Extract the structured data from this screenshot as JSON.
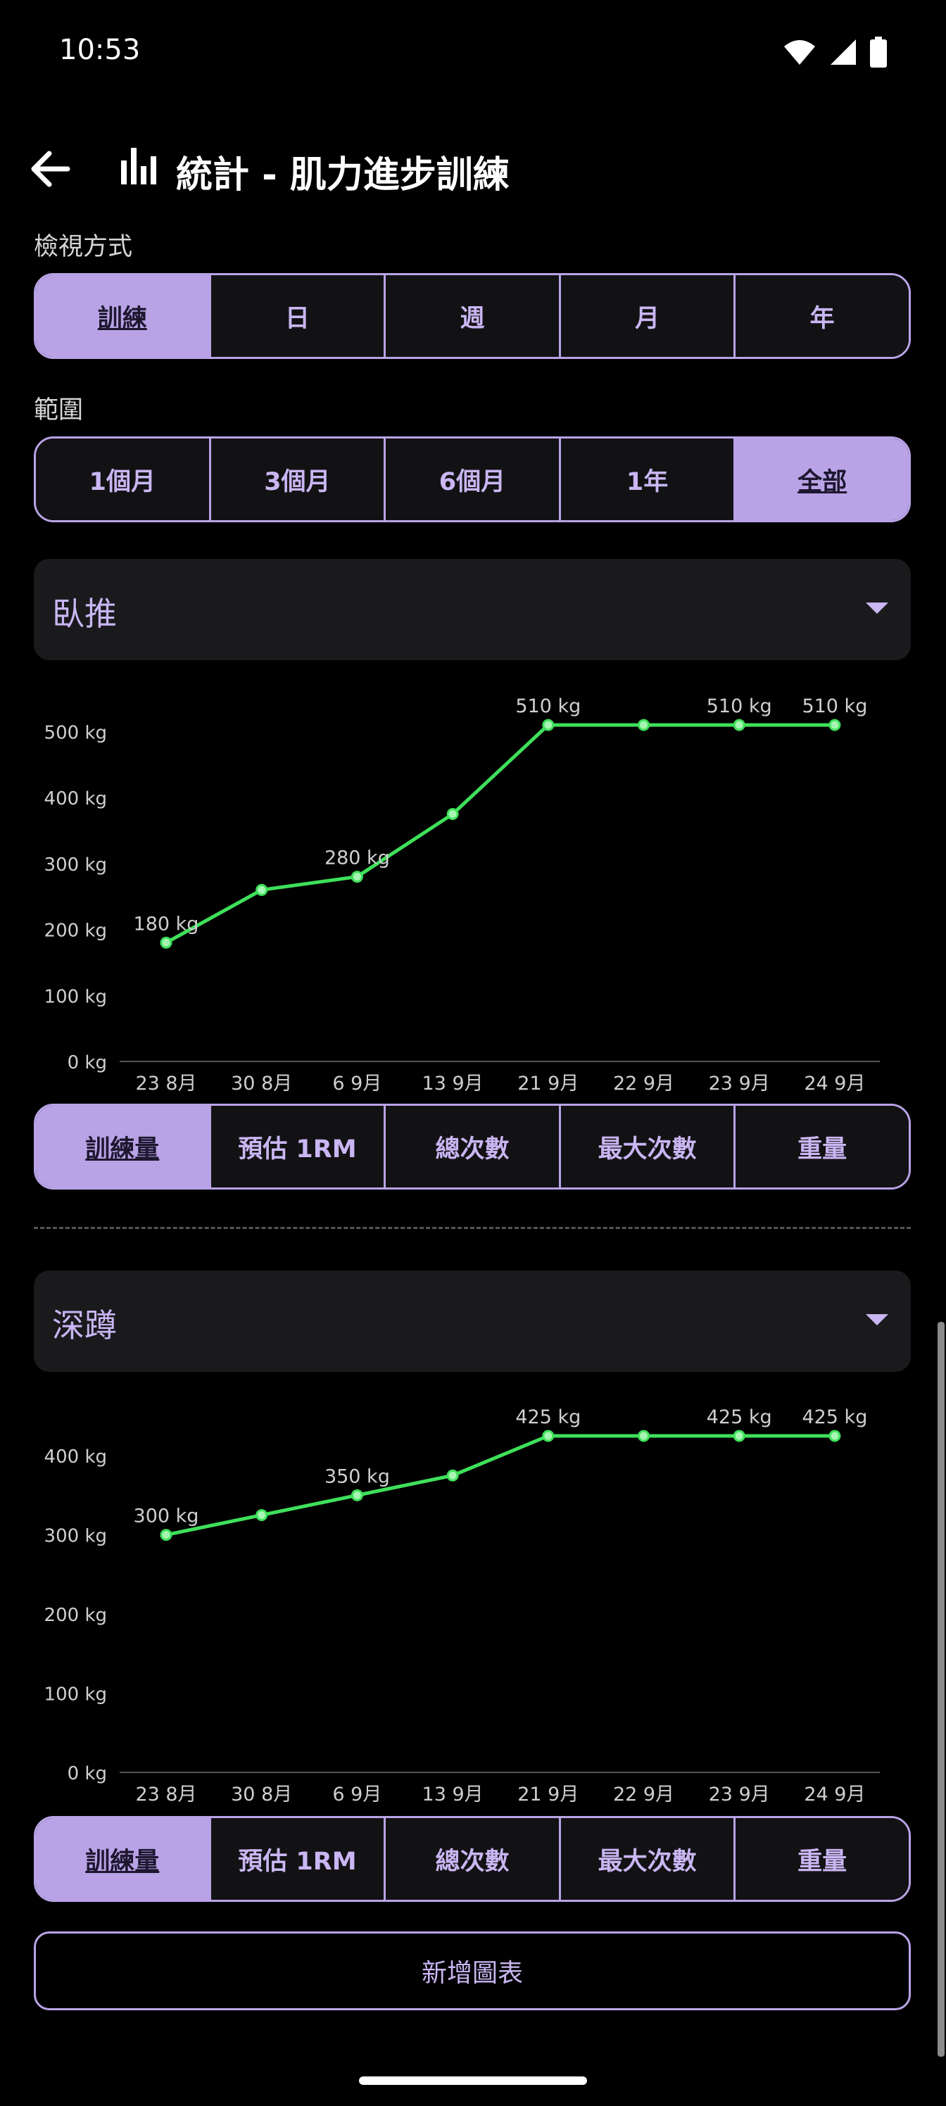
{
  "status": {
    "time": "10:53"
  },
  "header": {
    "title": "統計 - 肌力進步訓練"
  },
  "view_mode": {
    "label": "檢視方式",
    "options": [
      "訓練",
      "日",
      "週",
      "月",
      "年"
    ],
    "selected": "訓練"
  },
  "range": {
    "label": "範圍",
    "options": [
      "1個月",
      "3個月",
      "6個月",
      "1年",
      "全部"
    ],
    "selected": "全部"
  },
  "metric_options": [
    "訓練量",
    "預估 1RM",
    "總次數",
    "最大次數",
    "重量"
  ],
  "charts": [
    {
      "exercise": "臥推",
      "selected_metric": "訓練量",
      "chart_data": {
        "type": "line",
        "categories": [
          "23 8月",
          "30 8月",
          "6 9月",
          "13 9月",
          "21 9月",
          "22 9月",
          "23 9月",
          "24 9月"
        ],
        "values": [
          180,
          260,
          280,
          375,
          510,
          510,
          510,
          510
        ],
        "point_labels": [
          "180 kg",
          "",
          "280 kg",
          "",
          "510 kg",
          "",
          "510 kg",
          "510 kg"
        ],
        "y_ticks": [
          "0 kg",
          "100 kg",
          "200 kg",
          "300 kg",
          "400 kg",
          "500 kg"
        ],
        "y_tick_values": [
          0,
          100,
          200,
          300,
          400,
          500
        ],
        "ylim": [
          0,
          510
        ],
        "color": "#3ee05a"
      }
    },
    {
      "exercise": "深蹲",
      "selected_metric": "訓練量",
      "chart_data": {
        "type": "line",
        "categories": [
          "23 8月",
          "30 8月",
          "6 9月",
          "13 9月",
          "21 9月",
          "22 9月",
          "23 9月",
          "24 9月"
        ],
        "values": [
          300,
          325,
          350,
          375,
          425,
          425,
          425,
          425
        ],
        "point_labels": [
          "300 kg",
          "",
          "350 kg",
          "",
          "425 kg",
          "",
          "425 kg",
          "425 kg"
        ],
        "y_ticks": [
          "0 kg",
          "100 kg",
          "200 kg",
          "300 kg",
          "400 kg"
        ],
        "y_tick_values": [
          0,
          100,
          200,
          300,
          400
        ],
        "ylim": [
          0,
          425
        ],
        "color": "#3ee05a"
      }
    }
  ],
  "add_chart_label": "新增圖表",
  "colors": {
    "accent": "#b9a3e6",
    "line": "#3ee05a",
    "surface": "#1a1a1d"
  }
}
